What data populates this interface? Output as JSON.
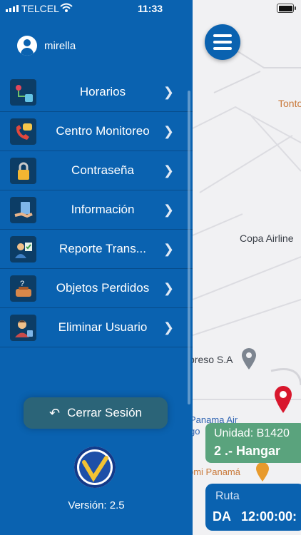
{
  "statusbar": {
    "carrier": "TELCEL",
    "time": "11:33"
  },
  "user": {
    "name": "mirella"
  },
  "menu": [
    {
      "label": "Horarios",
      "icon": "schedule-route-icon"
    },
    {
      "label": "Centro Monitoreo",
      "icon": "phone-chat-icon"
    },
    {
      "label": "Contraseña",
      "icon": "lock-icon"
    },
    {
      "label": "Información",
      "icon": "info-document-icon"
    },
    {
      "label": "Reporte Trans...",
      "icon": "report-user-icon"
    },
    {
      "label": "Objetos Perdidos",
      "icon": "lost-items-icon"
    },
    {
      "label": "Eliminar Usuario",
      "icon": "delete-user-icon"
    }
  ],
  "logout": {
    "label": "Cerrar Sesión"
  },
  "version": "Versión: 2.5",
  "map": {
    "labels": {
      "tonto": "Tonto",
      "copa": "Copa Airline",
      "preso": "preso S.A",
      "panama": "Panama Air",
      "go": "go",
      "romi": "omi Panamá"
    }
  },
  "unit_card": {
    "unit": "Unidad: B1420",
    "destination": "2 .- Hangar"
  },
  "route_card": {
    "title": "Ruta",
    "prefix": "DA",
    "time": "12:00:00:"
  },
  "colors": {
    "primary": "#0a62b0",
    "logout": "#2b6478",
    "unit_card": "#5aa37d"
  }
}
